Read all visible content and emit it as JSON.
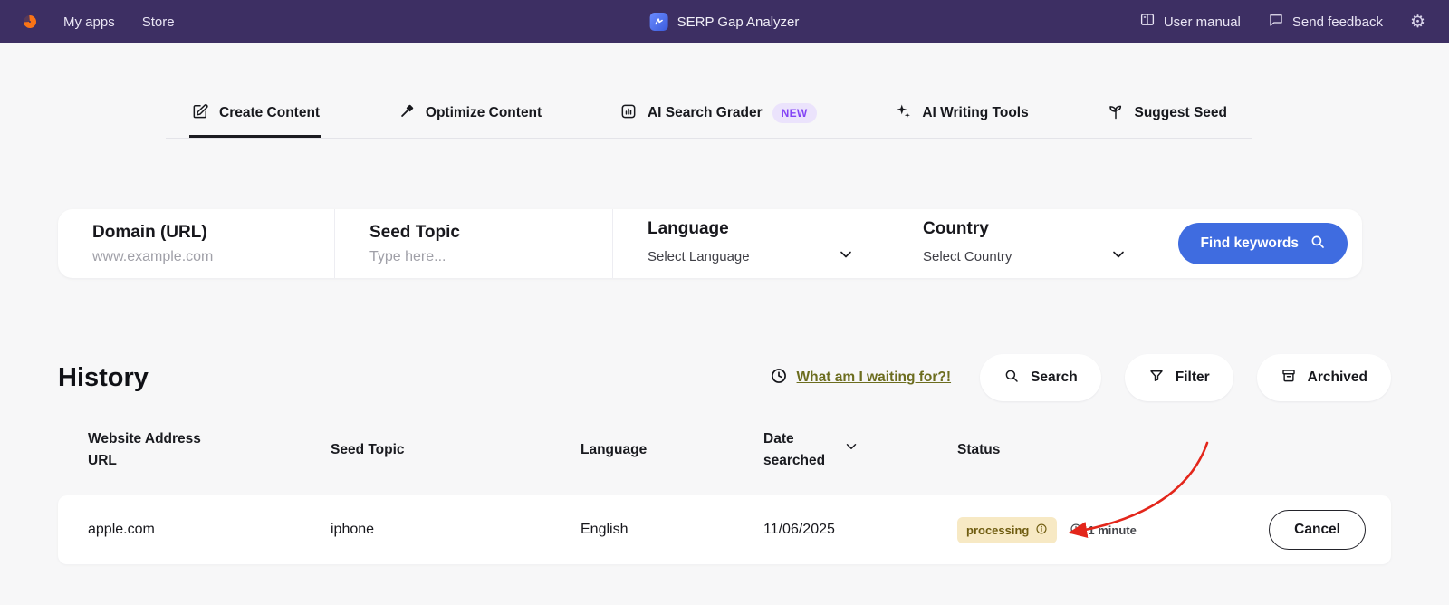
{
  "navbar": {
    "my_apps": "My apps",
    "store": "Store",
    "app_title": "SERP Gap Analyzer",
    "user_manual": "User manual",
    "send_feedback": "Send feedback"
  },
  "tabs": [
    {
      "label": "Create Content"
    },
    {
      "label": "Optimize Content"
    },
    {
      "label": "AI Search Grader",
      "badge": "NEW"
    },
    {
      "label": "AI Writing Tools"
    },
    {
      "label": "Suggest Seed"
    }
  ],
  "form": {
    "domain": {
      "label": "Domain (URL)",
      "placeholder": "www.example.com"
    },
    "seed": {
      "label": "Seed Topic",
      "placeholder": "Type here..."
    },
    "language": {
      "label": "Language",
      "value": "Select Language"
    },
    "country": {
      "label": "Country",
      "value": "Select Country"
    },
    "submit": "Find keywords"
  },
  "history": {
    "title": "History",
    "waiting_link": "What am I waiting for?!",
    "search": "Search",
    "filter": "Filter",
    "archived": "Archived",
    "columns": {
      "url": "Website Address URL",
      "seed": "Seed Topic",
      "language": "Language",
      "date": "Date searched",
      "status": "Status"
    },
    "row": {
      "url": "apple.com",
      "seed": "iphone",
      "language": "English",
      "date": "11/06/2025",
      "status": "processing",
      "elapsed": "1 minute",
      "action": "Cancel"
    }
  },
  "colors": {
    "navbar_bg": "#3d2f63",
    "logo_orange": "#f97316",
    "accent_blue": "#3f6ce0",
    "new_badge_bg": "#ebe3fc",
    "new_badge_text": "#8344f5",
    "status_badge_bg": "#f7e9c4",
    "status_badge_text": "#6f5c10",
    "waiting_link_text": "#6c6d1f",
    "arrow_red": "#e3261b"
  }
}
